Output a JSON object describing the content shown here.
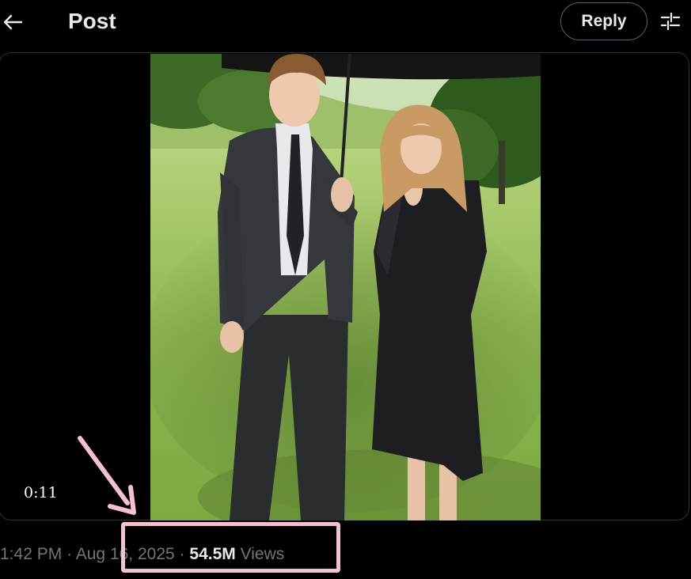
{
  "header": {
    "back_icon": "arrow-left-icon",
    "title": "Post",
    "reply_label": "Reply",
    "settings_icon": "sliders-icon"
  },
  "media": {
    "timestamp": "0:11"
  },
  "post_meta": {
    "time": "1:42 PM",
    "separator": "·",
    "date": "Aug 16, 2025",
    "views_count": "54.5M",
    "views_label": "Views"
  },
  "annotation": {
    "color": "#f6c1cf"
  },
  "colors": {
    "background": "#000000",
    "text_primary": "#e7e9ea",
    "text_secondary": "#71767b",
    "border": "#536471"
  }
}
